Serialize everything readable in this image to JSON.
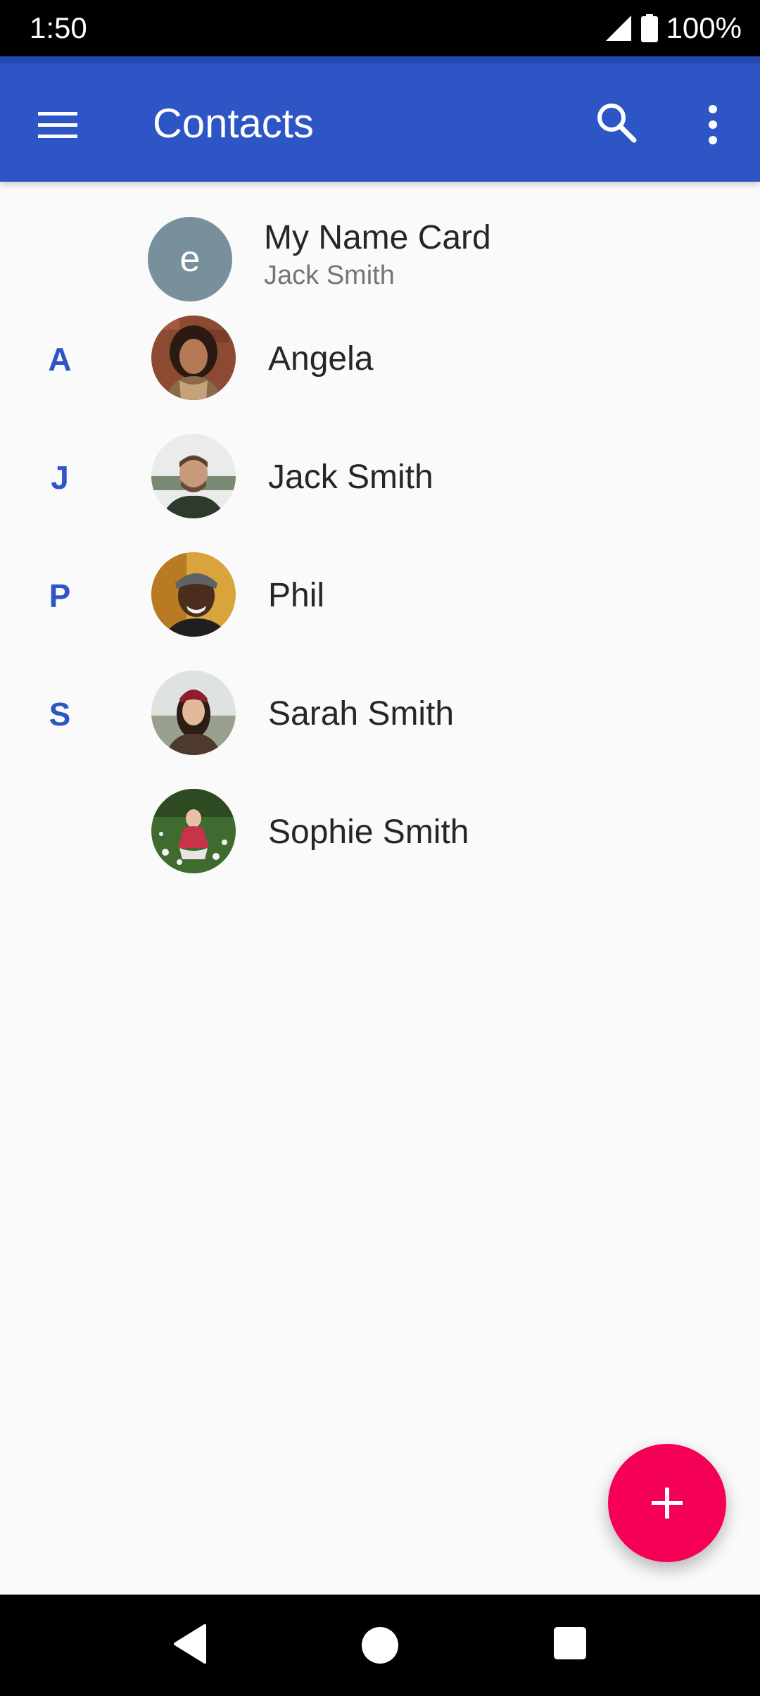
{
  "status_bar": {
    "time": "1:50",
    "battery_text": "100%",
    "icons": [
      "signal-icon",
      "battery-icon"
    ]
  },
  "app_bar": {
    "title": "Contacts",
    "icons": [
      "menu-icon",
      "search-icon",
      "more-vert-icon"
    ],
    "color": "#2d55c6"
  },
  "name_card": {
    "title": "My Name Card",
    "subtitle": "Jack Smith",
    "avatar_letter": "e",
    "avatar_color": "#78909c"
  },
  "contacts": [
    {
      "section": "A",
      "name": "Angela"
    },
    {
      "section": "J",
      "name": "Jack Smith"
    },
    {
      "section": "P",
      "name": "Phil"
    },
    {
      "section": "S",
      "name": "Sarah Smith"
    },
    {
      "section": "",
      "name": "Sophie Smith"
    }
  ],
  "fab": {
    "icon": "add-icon",
    "color": "#f50057"
  },
  "nav_bar": {
    "icons": [
      "back-icon",
      "home-icon",
      "recents-icon"
    ]
  }
}
